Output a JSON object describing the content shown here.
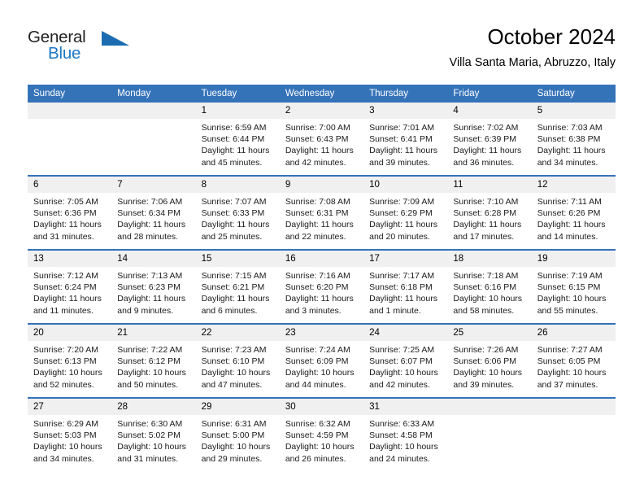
{
  "brand": {
    "name_part1": "General",
    "name_part2": "Blue",
    "accent_color": "#1b6cb0"
  },
  "header": {
    "title": "October 2024",
    "subtitle": "Villa Santa Maria, Abruzzo, Italy"
  },
  "theme": {
    "header_blue": "#3573b9",
    "daynum_band": "#f0f0f0"
  },
  "weekday_headers": [
    "Sunday",
    "Monday",
    "Tuesday",
    "Wednesday",
    "Thursday",
    "Friday",
    "Saturday"
  ],
  "labels": {
    "sunrise_prefix": "Sunrise:",
    "sunset_prefix": "Sunset:",
    "daylight_prefix": "Daylight:"
  },
  "weeks": [
    [
      {
        "day": "",
        "empty": true,
        "sunrise": "",
        "sunset": "",
        "daylight_line1": "",
        "daylight_line2": ""
      },
      {
        "day": "",
        "empty": true,
        "sunrise": "",
        "sunset": "",
        "daylight_line1": "",
        "daylight_line2": ""
      },
      {
        "day": "1",
        "empty": false,
        "sunrise": "Sunrise: 6:59 AM",
        "sunset": "Sunset: 6:44 PM",
        "daylight_line1": "Daylight: 11 hours",
        "daylight_line2": "and 45 minutes."
      },
      {
        "day": "2",
        "empty": false,
        "sunrise": "Sunrise: 7:00 AM",
        "sunset": "Sunset: 6:43 PM",
        "daylight_line1": "Daylight: 11 hours",
        "daylight_line2": "and 42 minutes."
      },
      {
        "day": "3",
        "empty": false,
        "sunrise": "Sunrise: 7:01 AM",
        "sunset": "Sunset: 6:41 PM",
        "daylight_line1": "Daylight: 11 hours",
        "daylight_line2": "and 39 minutes."
      },
      {
        "day": "4",
        "empty": false,
        "sunrise": "Sunrise: 7:02 AM",
        "sunset": "Sunset: 6:39 PM",
        "daylight_line1": "Daylight: 11 hours",
        "daylight_line2": "and 36 minutes."
      },
      {
        "day": "5",
        "empty": false,
        "sunrise": "Sunrise: 7:03 AM",
        "sunset": "Sunset: 6:38 PM",
        "daylight_line1": "Daylight: 11 hours",
        "daylight_line2": "and 34 minutes."
      }
    ],
    [
      {
        "day": "6",
        "empty": false,
        "sunrise": "Sunrise: 7:05 AM",
        "sunset": "Sunset: 6:36 PM",
        "daylight_line1": "Daylight: 11 hours",
        "daylight_line2": "and 31 minutes."
      },
      {
        "day": "7",
        "empty": false,
        "sunrise": "Sunrise: 7:06 AM",
        "sunset": "Sunset: 6:34 PM",
        "daylight_line1": "Daylight: 11 hours",
        "daylight_line2": "and 28 minutes."
      },
      {
        "day": "8",
        "empty": false,
        "sunrise": "Sunrise: 7:07 AM",
        "sunset": "Sunset: 6:33 PM",
        "daylight_line1": "Daylight: 11 hours",
        "daylight_line2": "and 25 minutes."
      },
      {
        "day": "9",
        "empty": false,
        "sunrise": "Sunrise: 7:08 AM",
        "sunset": "Sunset: 6:31 PM",
        "daylight_line1": "Daylight: 11 hours",
        "daylight_line2": "and 22 minutes."
      },
      {
        "day": "10",
        "empty": false,
        "sunrise": "Sunrise: 7:09 AM",
        "sunset": "Sunset: 6:29 PM",
        "daylight_line1": "Daylight: 11 hours",
        "daylight_line2": "and 20 minutes."
      },
      {
        "day": "11",
        "empty": false,
        "sunrise": "Sunrise: 7:10 AM",
        "sunset": "Sunset: 6:28 PM",
        "daylight_line1": "Daylight: 11 hours",
        "daylight_line2": "and 17 minutes."
      },
      {
        "day": "12",
        "empty": false,
        "sunrise": "Sunrise: 7:11 AM",
        "sunset": "Sunset: 6:26 PM",
        "daylight_line1": "Daylight: 11 hours",
        "daylight_line2": "and 14 minutes."
      }
    ],
    [
      {
        "day": "13",
        "empty": false,
        "sunrise": "Sunrise: 7:12 AM",
        "sunset": "Sunset: 6:24 PM",
        "daylight_line1": "Daylight: 11 hours",
        "daylight_line2": "and 11 minutes."
      },
      {
        "day": "14",
        "empty": false,
        "sunrise": "Sunrise: 7:13 AM",
        "sunset": "Sunset: 6:23 PM",
        "daylight_line1": "Daylight: 11 hours",
        "daylight_line2": "and 9 minutes."
      },
      {
        "day": "15",
        "empty": false,
        "sunrise": "Sunrise: 7:15 AM",
        "sunset": "Sunset: 6:21 PM",
        "daylight_line1": "Daylight: 11 hours",
        "daylight_line2": "and 6 minutes."
      },
      {
        "day": "16",
        "empty": false,
        "sunrise": "Sunrise: 7:16 AM",
        "sunset": "Sunset: 6:20 PM",
        "daylight_line1": "Daylight: 11 hours",
        "daylight_line2": "and 3 minutes."
      },
      {
        "day": "17",
        "empty": false,
        "sunrise": "Sunrise: 7:17 AM",
        "sunset": "Sunset: 6:18 PM",
        "daylight_line1": "Daylight: 11 hours",
        "daylight_line2": "and 1 minute."
      },
      {
        "day": "18",
        "empty": false,
        "sunrise": "Sunrise: 7:18 AM",
        "sunset": "Sunset: 6:16 PM",
        "daylight_line1": "Daylight: 10 hours",
        "daylight_line2": "and 58 minutes."
      },
      {
        "day": "19",
        "empty": false,
        "sunrise": "Sunrise: 7:19 AM",
        "sunset": "Sunset: 6:15 PM",
        "daylight_line1": "Daylight: 10 hours",
        "daylight_line2": "and 55 minutes."
      }
    ],
    [
      {
        "day": "20",
        "empty": false,
        "sunrise": "Sunrise: 7:20 AM",
        "sunset": "Sunset: 6:13 PM",
        "daylight_line1": "Daylight: 10 hours",
        "daylight_line2": "and 52 minutes."
      },
      {
        "day": "21",
        "empty": false,
        "sunrise": "Sunrise: 7:22 AM",
        "sunset": "Sunset: 6:12 PM",
        "daylight_line1": "Daylight: 10 hours",
        "daylight_line2": "and 50 minutes."
      },
      {
        "day": "22",
        "empty": false,
        "sunrise": "Sunrise: 7:23 AM",
        "sunset": "Sunset: 6:10 PM",
        "daylight_line1": "Daylight: 10 hours",
        "daylight_line2": "and 47 minutes."
      },
      {
        "day": "23",
        "empty": false,
        "sunrise": "Sunrise: 7:24 AM",
        "sunset": "Sunset: 6:09 PM",
        "daylight_line1": "Daylight: 10 hours",
        "daylight_line2": "and 44 minutes."
      },
      {
        "day": "24",
        "empty": false,
        "sunrise": "Sunrise: 7:25 AM",
        "sunset": "Sunset: 6:07 PM",
        "daylight_line1": "Daylight: 10 hours",
        "daylight_line2": "and 42 minutes."
      },
      {
        "day": "25",
        "empty": false,
        "sunrise": "Sunrise: 7:26 AM",
        "sunset": "Sunset: 6:06 PM",
        "daylight_line1": "Daylight: 10 hours",
        "daylight_line2": "and 39 minutes."
      },
      {
        "day": "26",
        "empty": false,
        "sunrise": "Sunrise: 7:27 AM",
        "sunset": "Sunset: 6:05 PM",
        "daylight_line1": "Daylight: 10 hours",
        "daylight_line2": "and 37 minutes."
      }
    ],
    [
      {
        "day": "27",
        "empty": false,
        "sunrise": "Sunrise: 6:29 AM",
        "sunset": "Sunset: 5:03 PM",
        "daylight_line1": "Daylight: 10 hours",
        "daylight_line2": "and 34 minutes."
      },
      {
        "day": "28",
        "empty": false,
        "sunrise": "Sunrise: 6:30 AM",
        "sunset": "Sunset: 5:02 PM",
        "daylight_line1": "Daylight: 10 hours",
        "daylight_line2": "and 31 minutes."
      },
      {
        "day": "29",
        "empty": false,
        "sunrise": "Sunrise: 6:31 AM",
        "sunset": "Sunset: 5:00 PM",
        "daylight_line1": "Daylight: 10 hours",
        "daylight_line2": "and 29 minutes."
      },
      {
        "day": "30",
        "empty": false,
        "sunrise": "Sunrise: 6:32 AM",
        "sunset": "Sunset: 4:59 PM",
        "daylight_line1": "Daylight: 10 hours",
        "daylight_line2": "and 26 minutes."
      },
      {
        "day": "31",
        "empty": false,
        "sunrise": "Sunrise: 6:33 AM",
        "sunset": "Sunset: 4:58 PM",
        "daylight_line1": "Daylight: 10 hours",
        "daylight_line2": "and 24 minutes."
      },
      {
        "day": "",
        "empty": true,
        "sunrise": "",
        "sunset": "",
        "daylight_line1": "",
        "daylight_line2": ""
      },
      {
        "day": "",
        "empty": true,
        "sunrise": "",
        "sunset": "",
        "daylight_line1": "",
        "daylight_line2": ""
      }
    ]
  ]
}
